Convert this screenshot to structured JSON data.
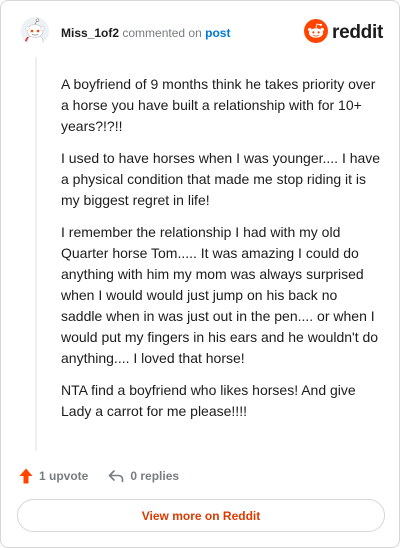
{
  "header": {
    "username": "Miss_1of2",
    "verb": "commented on",
    "post_link": "post",
    "brand": "reddit"
  },
  "comment": {
    "paragraphs": [
      "A boyfriend of 9 months think he takes priority over a horse you have built a relationship with for 10+ years?!?!!",
      "I used to have horses when I was younger.... I have a physical condition that made me stop riding it is my biggest regret in life!",
      "I remember the relationship I had with my old Quarter horse Tom..... It was amazing I could do anything with him my mom was always surprised when I would would just jump on his back no saddle when in was just out in the pen.... or when I would put my fingers in his ears and he wouldn't do anything.... I loved that horse!",
      "NTA find a boyfriend who likes horses! And give Lady a carrot for me please!!!!"
    ]
  },
  "actions": {
    "upvote_label": "1 upvote",
    "replies_label": "0 replies"
  },
  "footer": {
    "view_more_label": "View more on Reddit"
  },
  "colors": {
    "accent": "#ff4500",
    "link": "#0079d3",
    "view_more": "#d93a00",
    "muted": "#787c7e"
  },
  "icons": {
    "avatar": "snoo-avatar-icon",
    "brand": "reddit-logo-icon",
    "upvote": "upvote-arrow-icon",
    "reply": "reply-arrow-icon"
  }
}
